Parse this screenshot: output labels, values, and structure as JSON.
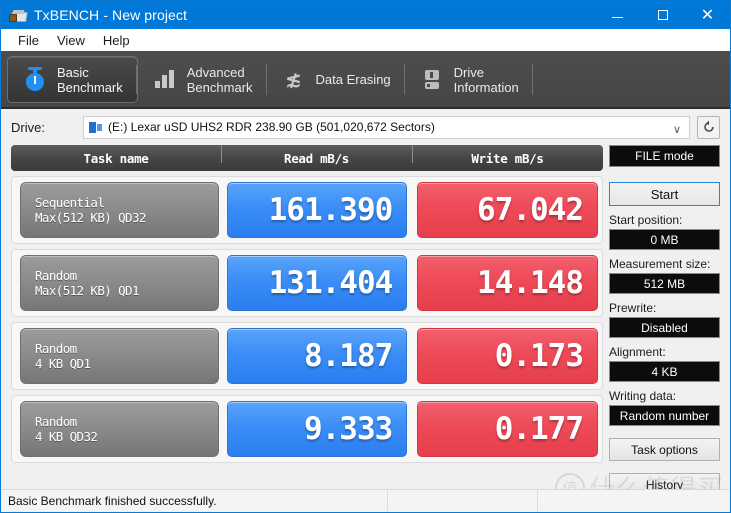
{
  "window": {
    "title": "TxBENCH - New project",
    "icon": "app-icon",
    "controls": {
      "minimize": "—",
      "maximize": "□",
      "close": "✕"
    }
  },
  "menubar": {
    "items": [
      "File",
      "View",
      "Help"
    ]
  },
  "tabs": [
    {
      "label": "Basic\nBenchmark",
      "icon": "stopwatch-icon",
      "active": true
    },
    {
      "label": "Advanced\nBenchmark",
      "icon": "bar-chart-icon",
      "active": false
    },
    {
      "label": "Data Erasing",
      "icon": "shredder-icon",
      "active": false
    },
    {
      "label": "Drive\nInformation",
      "icon": "drive-icon",
      "active": false
    }
  ],
  "drive": {
    "label": "Drive:",
    "selected": "(E:) Lexar uSD UHS2 RDR  238.90 GB (501,020,672 Sectors)",
    "chevron": "∨",
    "refresh_icon": "refresh-icon"
  },
  "table": {
    "headers": [
      "Task name",
      "Read mB/s",
      "Write mB/s"
    ],
    "rows": [
      {
        "task_line1": "Sequential",
        "task_line2": "Max(512 KB) QD32",
        "read": "161.390",
        "write": "67.042"
      },
      {
        "task_line1": "Random",
        "task_line2": "Max(512 KB) QD1",
        "read": "131.404",
        "write": "14.148"
      },
      {
        "task_line1": "Random",
        "task_line2": "4 KB QD1",
        "read": "8.187",
        "write": "0.173"
      },
      {
        "task_line1": "Random",
        "task_line2": "4 KB QD32",
        "read": "9.333",
        "write": "0.177"
      }
    ]
  },
  "sidepanel": {
    "mode_button": "FILE mode",
    "start_button": "Start",
    "fields": [
      {
        "label": "Start position:",
        "value": "0 MB"
      },
      {
        "label": "Measurement size:",
        "value": "512 MB"
      },
      {
        "label": "Prewrite:",
        "value": "Disabled"
      },
      {
        "label": "Alignment:",
        "value": "4 KB"
      },
      {
        "label": "Writing data:",
        "value": "Random number"
      }
    ],
    "task_options_button": "Task options",
    "history_button": "History"
  },
  "statusbar": {
    "message": "Basic Benchmark finished successfully.",
    "cell2": "",
    "cell3": ""
  },
  "watermark": {
    "text": "什么值得买",
    "logo": "值"
  },
  "colors": {
    "title_bar": "#0078d7",
    "read_cell": "#3b8df6",
    "write_cell": "#ee4a58",
    "tabstrip": "#4a4a4a",
    "accent_border": "#2b85d8"
  }
}
